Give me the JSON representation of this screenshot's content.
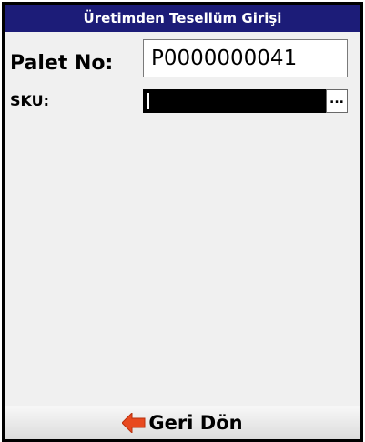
{
  "window": {
    "title": "Üretimden Tesellüm Girişi"
  },
  "form": {
    "palet_label": "Palet No:",
    "palet_value": "P0000000041",
    "sku_label": "SKU:",
    "sku_value": "",
    "lookup_button_label": "..."
  },
  "footer": {
    "back_label": "Geri Dön",
    "back_icon": "arrow-left-icon"
  },
  "colors": {
    "title_bar": "#1c1c78",
    "background": "#f0f0f0",
    "back_arrow": "#e8491f"
  }
}
